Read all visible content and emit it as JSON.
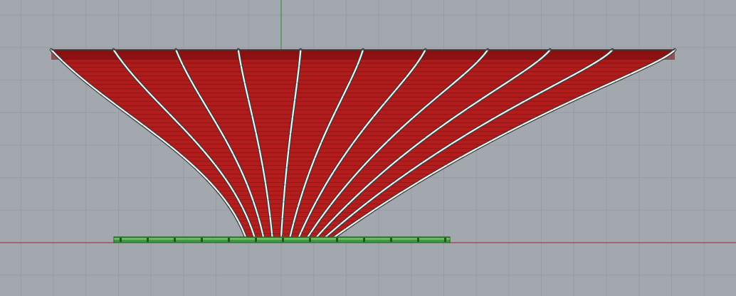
{
  "viewport": {
    "background_color": "#a3a7ae",
    "grid_minor_color": "#989ca3",
    "grid_major_color": "#8e9299",
    "axis_x_color": "#9e2a2a",
    "axis_y_color": "#2f8a3a"
  },
  "model": {
    "shell_color": "#b81d1d",
    "shell_dark_color": "#7e0f0f",
    "rib_color": "#f0f0f0",
    "rib_outline_color": "#3a3a3a",
    "base_color": "#3f9a3f",
    "base_highlight_color": "#a8e0a0",
    "rib_count": 11
  }
}
